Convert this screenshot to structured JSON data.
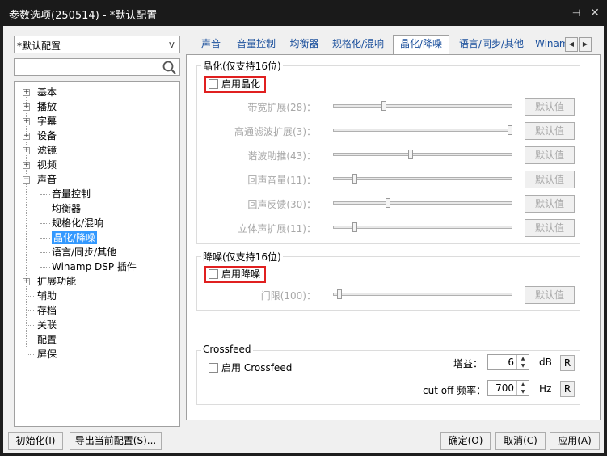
{
  "window": {
    "title": "参数选项(250514) - *默认配置",
    "pin_glyph": "⊣",
    "close_glyph": "✕"
  },
  "sidebar": {
    "preset_value": "*默认配置",
    "preset_arrow": "v",
    "search_placeholder": "",
    "tree": [
      {
        "label": "基本",
        "expander": "+"
      },
      {
        "label": "播放",
        "expander": "+"
      },
      {
        "label": "字幕",
        "expander": "+"
      },
      {
        "label": "设备",
        "expander": "+"
      },
      {
        "label": "滤镜",
        "expander": "+"
      },
      {
        "label": "视频",
        "expander": "+"
      },
      {
        "label": "声音",
        "expander": "−"
      },
      {
        "label": "扩展功能",
        "expander": "+"
      },
      {
        "label": "辅助",
        "expander": ""
      },
      {
        "label": "存档",
        "expander": ""
      },
      {
        "label": "关联",
        "expander": ""
      },
      {
        "label": "配置",
        "expander": ""
      },
      {
        "label": "屏保",
        "expander": ""
      }
    ],
    "sound_children": [
      "音量控制",
      "均衡器",
      "规格化/混响",
      "晶化/降噪",
      "语言/同步/其他",
      "Winamp DSP 插件"
    ],
    "selected_child": "晶化/降噪"
  },
  "tabs": {
    "items": [
      "声音",
      "音量控制",
      "均衡器",
      "规格化/混响",
      "晶化/降噪",
      "语言/同步/其他",
      "Winam"
    ],
    "active": "晶化/降噪",
    "scroll_left": "◀",
    "scroll_right": "▶"
  },
  "crystal": {
    "group_title": "晶化(仅支持16位)",
    "enable_label": "启用晶化",
    "enabled": false,
    "sliders": [
      {
        "label": "带宽扩展(28)：",
        "value": 28,
        "fraction": 0.28
      },
      {
        "label": "高通滤波扩展(3)：",
        "value": 3,
        "fraction": 1.0
      },
      {
        "label": "谐波助推(43)：",
        "value": 43,
        "fraction": 0.43
      },
      {
        "label": "回声音量(11)：",
        "value": 11,
        "fraction": 0.11
      },
      {
        "label": "回声反馈(30)：",
        "value": 30,
        "fraction": 0.3
      },
      {
        "label": "立体声扩展(11)：",
        "value": 11,
        "fraction": 0.11
      }
    ],
    "default_button": "默认值"
  },
  "denoise": {
    "group_title": "降噪(仅支持16位)",
    "enable_label": "启用降噪",
    "enabled": false,
    "threshold_label": "门限(100)：",
    "threshold_value": 100,
    "threshold_fraction": 0.0,
    "default_button": "默认值"
  },
  "crossfeed": {
    "group_title": "Crossfeed",
    "enable_label": "启用 Crossfeed",
    "enabled": false,
    "gain_label": "增益：",
    "gain_value": "6",
    "gain_unit": "dB",
    "cutoff_label": "cut off 频率：",
    "cutoff_value": "700",
    "cutoff_unit": "Hz",
    "reset_label": "R"
  },
  "bottom": {
    "init_button": "初始化(I)",
    "export_button": "导出当前配置(S)...",
    "ok_button": "确定(O)",
    "cancel_button": "取消(C)",
    "apply_button": "应用(A)"
  }
}
